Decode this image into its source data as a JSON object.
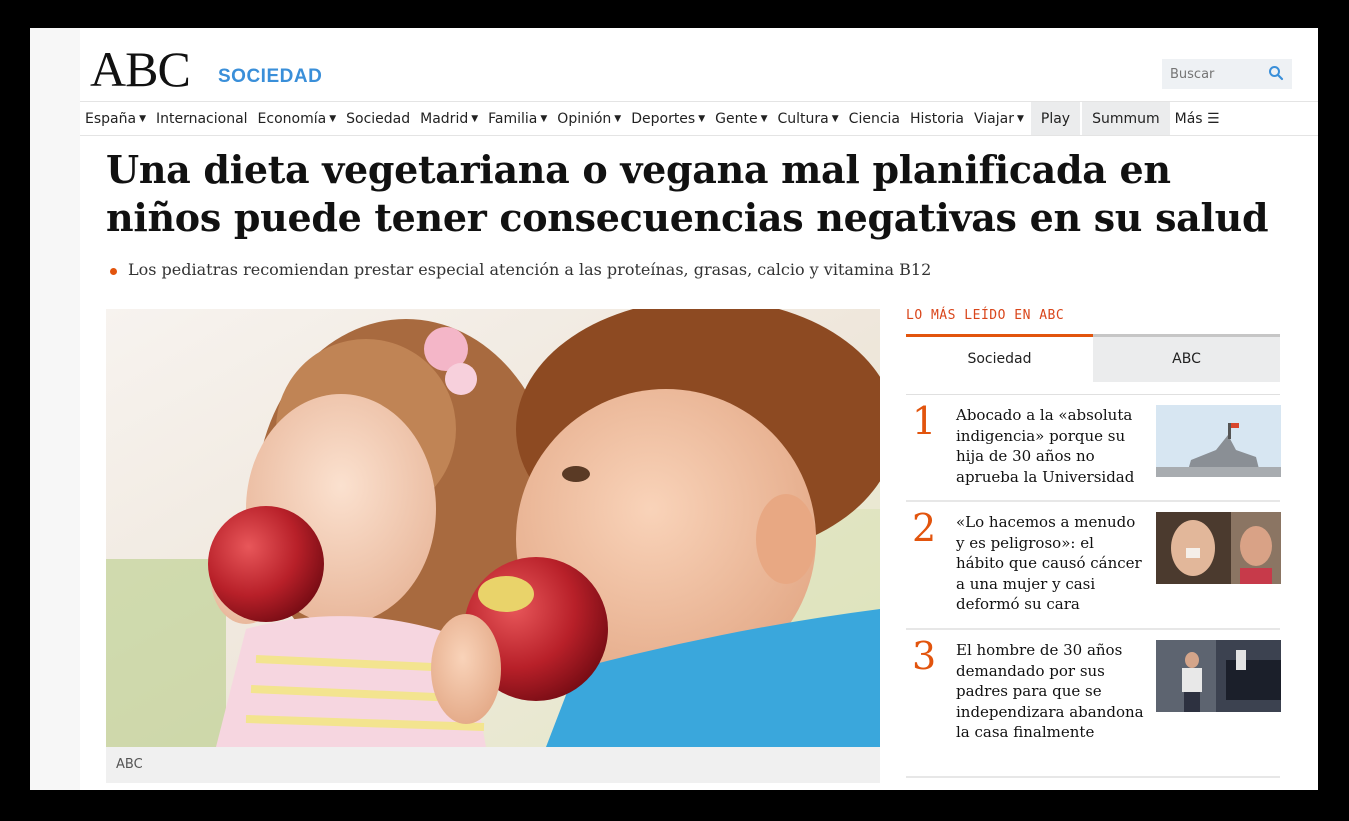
{
  "header": {
    "logo": "ABC",
    "section": "SOCIEDAD",
    "search_placeholder": "Buscar"
  },
  "nav": [
    {
      "label": "España",
      "caret": true
    },
    {
      "label": "Internacional",
      "caret": false
    },
    {
      "label": "Economía",
      "caret": true
    },
    {
      "label": "Sociedad",
      "caret": false
    },
    {
      "label": "Madrid",
      "caret": true
    },
    {
      "label": "Familia",
      "caret": true
    },
    {
      "label": "Opinión",
      "caret": true
    },
    {
      "label": "Deportes",
      "caret": true
    },
    {
      "label": "Gente",
      "caret": true
    },
    {
      "label": "Cultura",
      "caret": true
    },
    {
      "label": "Ciencia",
      "caret": false
    },
    {
      "label": "Historia",
      "caret": false
    },
    {
      "label": "Viajar",
      "caret": true
    },
    {
      "label": "Play",
      "caret": false
    },
    {
      "label": "Summum",
      "caret": false
    },
    {
      "label": "Más ☰",
      "caret": false
    }
  ],
  "article": {
    "headline": "Una dieta vegetariana o vegana mal planificada en niños puede tener consecuencias negativas en su salud",
    "subheadline": "Los pediatras recomiendan prestar especial atención a las proteínas, grasas, calcio y vitamina B12",
    "photo_credit": "ABC"
  },
  "most_read": {
    "title": "LO MÁS LEÍDO EN ABC",
    "tabs": [
      "Sociedad",
      "ABC"
    ],
    "items": [
      {
        "rank": "1",
        "text": "Abocado a la «absoluta indigencia» porque su hija de 30 años no aprueba la Universidad"
      },
      {
        "rank": "2",
        "text": "«Lo hacemos a menudo y es peligroso»: el hábito que causó cáncer a una mujer y casi deformó su cara"
      },
      {
        "rank": "3",
        "text": "El hombre de 30 años demandado por sus padres para que se independizara abandona la casa finalmente"
      }
    ]
  },
  "colors": {
    "accent": "#e2540d",
    "section_blue": "#3a8fd9"
  }
}
